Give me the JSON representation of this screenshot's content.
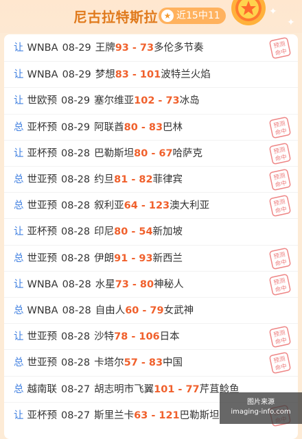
{
  "header": {
    "title": "尼古拉特斯拉",
    "badge": "近15中11",
    "badge_icon": "star-icon"
  },
  "colors": {
    "background": "#fdebd6",
    "accent": "#e07a1c",
    "score": "#f0602c",
    "type_label": "#3f7fe0",
    "stamp": "#e85c5c"
  },
  "stamp": {
    "line1": "预测",
    "line2": "命中"
  },
  "rows": [
    {
      "type": "让",
      "league": "WNBA",
      "date": "08-29",
      "home": "王牌",
      "home_score": "93",
      "away_score": "73",
      "away": "多伦多节奏",
      "hit": true
    },
    {
      "type": "让",
      "league": "WNBA",
      "date": "08-29",
      "home": "梦想",
      "home_score": "83",
      "away_score": "101",
      "away": "波特兰火焰",
      "hit": false
    },
    {
      "type": "让",
      "league": "世欧预",
      "date": "08-29",
      "home": "塞尔维亚",
      "home_score": "102",
      "away_score": "73",
      "away": "冰岛",
      "hit": false
    },
    {
      "type": "总",
      "league": "亚杯预",
      "date": "08-29",
      "home": "阿联酋",
      "home_score": "80",
      "away_score": "83",
      "away": "巴林",
      "hit": true
    },
    {
      "type": "让",
      "league": "亚杯预",
      "date": "08-28",
      "home": "巴勒斯坦",
      "home_score": "80",
      "away_score": "67",
      "away": "哈萨克",
      "hit": true
    },
    {
      "type": "总",
      "league": "世亚预",
      "date": "08-28",
      "home": "约旦",
      "home_score": "81",
      "away_score": "82",
      "away": "菲律宾",
      "hit": true
    },
    {
      "type": "总",
      "league": "世亚预",
      "date": "08-28",
      "home": "叙利亚",
      "home_score": "64",
      "away_score": "123",
      "away": "澳大利亚",
      "hit": true
    },
    {
      "type": "让",
      "league": "亚杯预",
      "date": "08-28",
      "home": "印尼",
      "home_score": "80",
      "away_score": "54",
      "away": "新加坡",
      "hit": false
    },
    {
      "type": "总",
      "league": "世亚预",
      "date": "08-28",
      "home": "伊朗",
      "home_score": "91",
      "away_score": "93",
      "away": "新西兰",
      "hit": true
    },
    {
      "type": "让",
      "league": "WNBA",
      "date": "08-28",
      "home": "水星",
      "home_score": "73",
      "away_score": "80",
      "away": "神秘人",
      "hit": true
    },
    {
      "type": "总",
      "league": "WNBA",
      "date": "08-28",
      "home": "自由人",
      "home_score": "60",
      "away_score": "79",
      "away": "女武神",
      "hit": false
    },
    {
      "type": "让",
      "league": "世亚预",
      "date": "08-28",
      "home": "沙特",
      "home_score": "78",
      "away_score": "106",
      "away": "日本",
      "hit": true
    },
    {
      "type": "总",
      "league": "世亚预",
      "date": "08-28",
      "home": "卡塔尔",
      "home_score": "57",
      "away_score": "83",
      "away": "中国",
      "hit": true
    },
    {
      "type": "总",
      "league": "越南联",
      "date": "08-27",
      "home": "胡志明市飞翼",
      "home_score": "101",
      "away_score": "77",
      "away": "芹苴鲶鱼",
      "hit": false
    },
    {
      "type": "让",
      "league": "亚杯预",
      "date": "08-27",
      "home": "斯里兰卡",
      "home_score": "63",
      "away_score": "121",
      "away": "巴勒斯坦",
      "hit": true
    }
  ],
  "watermark": {
    "line1": "图片来源",
    "line2": "imaging-info.com"
  }
}
